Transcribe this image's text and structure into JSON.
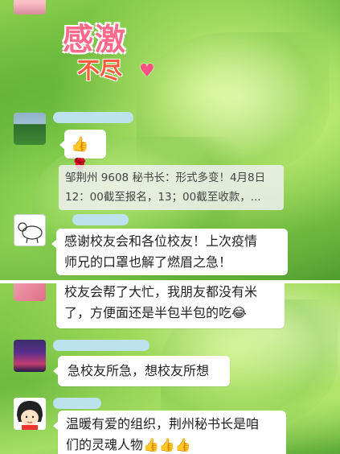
{
  "title_art": {
    "main": "感激",
    "sub": "不尽"
  },
  "messages": {
    "m1": {
      "emojis": "👍🌹"
    },
    "m2": {
      "quote_line1": "邹荆州 9608 秘书长：形式多变！4月8日",
      "quote_line2": "12：00截至报名，13；00截至收款，..."
    },
    "m3": {
      "line1": "感谢校友会和各位校友！上次疫情",
      "line2": "师兄的口罩也解了燃眉之急！"
    },
    "m4": {
      "line1": "校友会帮了大忙，我朋友都没有米",
      "line2": "了，方便面还是半包半包的吃😂"
    },
    "m5": {
      "line1": "急校友所急，想校友所想"
    },
    "m6": {
      "line1": "温暖有爱的组织，荆州秘书长是咱",
      "line2": "们的灵魂人物👍👍👍"
    }
  }
}
